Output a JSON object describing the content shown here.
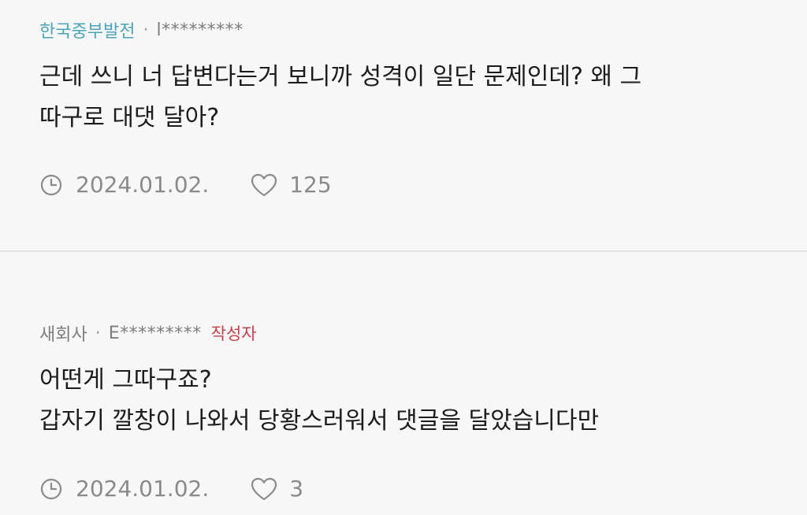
{
  "comments": [
    {
      "company": "한국중부발전",
      "separator": "·",
      "author": "l*********",
      "text": "근데 쓰니 너 답변다는거 보니까 성격이 일단 문제인데? 왜 그\n따구로 대댓 달아?",
      "date": "2024.01.02.",
      "likes": "125",
      "icons": {
        "date": "clock-icon",
        "likes": "heart-icon"
      }
    },
    {
      "company": "새회사",
      "separator": "·",
      "author": "E*********",
      "badge": "작성자",
      "text": "어떤게 그따구죠?\n갑자기 깔창이 나와서 당황스러워서 댓글을 달았습니다만",
      "date": "2024.01.02.",
      "likes": "3",
      "icons": {
        "date": "clock-icon",
        "likes": "heart-icon"
      }
    }
  ],
  "colors": {
    "background": "#f7f7f7",
    "company_accent": "#4aa3b8",
    "meta_gray": "#7d7d7d",
    "writer_badge": "#c2424a",
    "divider": "#e3e3e3"
  }
}
